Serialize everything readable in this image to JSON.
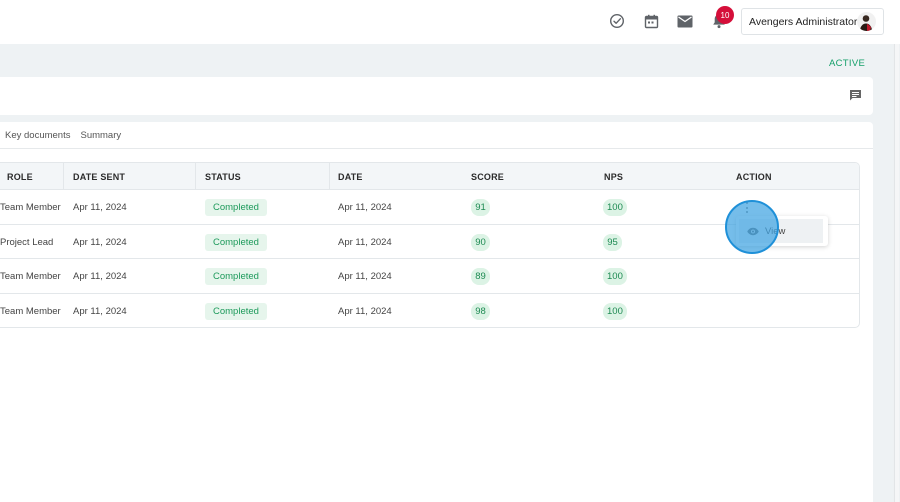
{
  "header": {
    "user_name": "Avengers Administrator",
    "notification_count": "10",
    "icons": [
      "check-circle-icon",
      "calendar-icon",
      "mail-icon",
      "bell-icon"
    ]
  },
  "status": {
    "label": "ACTIVE",
    "color": "#16a06a"
  },
  "tabs": [
    {
      "label": "Key documents"
    },
    {
      "label": "Summary"
    }
  ],
  "table": {
    "headers": {
      "role": "ROLE",
      "date_sent": "DATE SENT",
      "status": "STATUS",
      "date": "DATE",
      "score": "SCORE",
      "nps": "NPS",
      "action": "ACTION"
    },
    "rows": [
      {
        "role": "Team Member",
        "date_sent": "Apr 11, 2024",
        "status": "Completed",
        "date": "Apr 11, 2024",
        "score": "91",
        "nps": "100"
      },
      {
        "role": "Project Lead",
        "date_sent": "Apr 11, 2024",
        "status": "Completed",
        "date": "Apr 11, 2024",
        "score": "90",
        "nps": "95"
      },
      {
        "role": "Team Member",
        "date_sent": "Apr 11, 2024",
        "status": "Completed",
        "date": "Apr 11, 2024",
        "score": "89",
        "nps": "100"
      },
      {
        "role": "Team Member",
        "date_sent": "Apr 11, 2024",
        "status": "Completed",
        "date": "Apr 11, 2024",
        "score": "98",
        "nps": "100"
      }
    ]
  },
  "action_menu": {
    "items": [
      {
        "label": "View",
        "icon": "eye-icon"
      }
    ]
  },
  "colors": {
    "accent_green": "#1d9a5b",
    "badge_red": "#d50f3a",
    "click_highlight": "#40a3e2"
  }
}
